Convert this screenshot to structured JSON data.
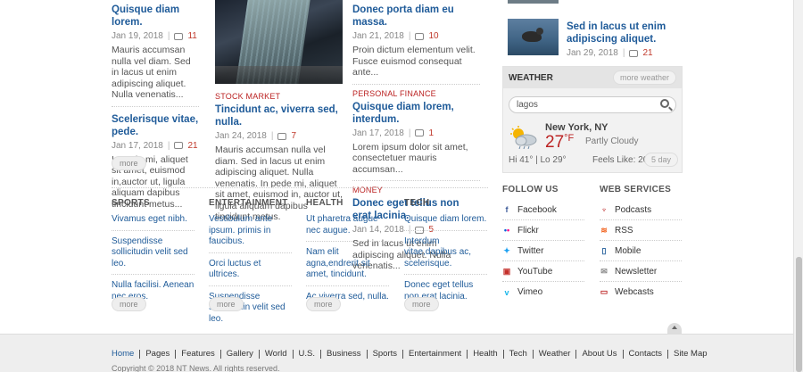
{
  "col1": {
    "articles": [
      {
        "title": "Quisque diam lorem.",
        "date": "Jan 19, 2018",
        "comments": "11",
        "excerpt": "Mauris accumsan nulla vel diam. Sed in lacus ut enim adipiscing aliquet. Nulla venenatis..."
      },
      {
        "title": "Scelerisque vitae, pede.",
        "date": "Jan 17, 2018",
        "comments": "21",
        "excerpt": "In pede mi, aliquet sit amet, euismod in,auctor ut, ligula aliquam dapibus tincidunt metus..."
      }
    ],
    "more": "more"
  },
  "col2": {
    "category": "STOCK MARKET",
    "title": "Tincidunt ac, viverra sed, nulla.",
    "date": "Jan 24, 2018",
    "comments": "7",
    "excerpt": "Mauris accumsan nulla vel diam. Sed in lacus ut enim adipiscing aliquet. Nulla venenatis. In pede mi, aliquet sit amet, euismod in, auctor ut, ligula aliquam dapibus tincidunt metus."
  },
  "col3": {
    "articles": [
      {
        "category": "",
        "title": "Donec porta diam eu massa.",
        "date": "Jan 21, 2018",
        "comments": "10",
        "excerpt": "Proin dictum elementum velit. Fusce euismod consequat ante..."
      },
      {
        "category": "PERSONAL FINANCE",
        "title": "Quisque diam lorem, interdum.",
        "date": "Jan 17, 2018",
        "comments": "1",
        "excerpt": "Lorem ipsum dolor sit amet, consectetuer mauris accumsan..."
      },
      {
        "category": "MONEY",
        "title": "Donec eget tellus non erat lacinia.",
        "date": "Jan 14, 2018",
        "comments": "5",
        "excerpt": "Sed in lacus ut enim adipiscing aliquet. Nulla venenatis..."
      }
    ]
  },
  "sidebar_article": {
    "title": "Sed in lacus ut enim adipiscing aliquet.",
    "date": "Jan 29, 2018",
    "comments": "21"
  },
  "weather": {
    "heading": "WEATHER",
    "more": "more weather",
    "search_value": "lagos",
    "city": "New York, NY",
    "temp": "27",
    "unit": "°F",
    "condition": "Partly Cloudy",
    "hilo": "Hi 41° | Lo 29°",
    "feels": "Feels Like: 20°",
    "five_day": "5 day"
  },
  "categories": [
    {
      "heading": "SPORTS",
      "links": [
        "Vivamus eget nibh.",
        "Suspendisse sollicitudin velit sed leo.",
        "Nulla facilisi. Aenean nec eros."
      ],
      "more": "more"
    },
    {
      "heading": "ENTERTAINMENT",
      "links": [
        "Vestibulum ante ipsum. primis in faucibus.",
        "Orci luctus et ultrices.",
        "Suspendisse sollicitudin velit sed leo."
      ],
      "more": "more"
    },
    {
      "heading": "HEALTH",
      "links": [
        "Ut pharetra augue nec augue.",
        "Nam elit agna,endrerit sit amet, tincidunt.",
        "Ac viverra sed, nulla."
      ],
      "more": "more"
    },
    {
      "heading": "TECH",
      "links": [
        "Quisque diam lorem.",
        "Interdum vitae,dapibus ac, scelerisque.",
        "Donec eget tellus non erat lacinia."
      ],
      "more": "more"
    }
  ],
  "follow_us": {
    "heading": "FOLLOW US",
    "items": [
      {
        "label": "Facebook",
        "icon": "facebook-icon"
      },
      {
        "label": "Flickr",
        "icon": "flickr-icon"
      },
      {
        "label": "Twitter",
        "icon": "twitter-icon"
      },
      {
        "label": "YouTube",
        "icon": "youtube-icon"
      },
      {
        "label": "Vimeo",
        "icon": "vimeo-icon"
      }
    ]
  },
  "web_services": {
    "heading": "WEB SERVICES",
    "items": [
      {
        "label": "Podcasts",
        "icon": "podcast-icon"
      },
      {
        "label": "RSS",
        "icon": "rss-icon"
      },
      {
        "label": "Mobile",
        "icon": "mobile-icon"
      },
      {
        "label": "Newsletter",
        "icon": "envelope-icon"
      },
      {
        "label": "Webcasts",
        "icon": "monitor-icon"
      }
    ]
  },
  "footer": {
    "nav": [
      "Home",
      "Pages",
      "Features",
      "Gallery",
      "World",
      "U.S.",
      "Business",
      "Sports",
      "Entertainment",
      "Health",
      "Tech",
      "Weather",
      "About Us",
      "Contacts",
      "Site Map"
    ],
    "copyright": "Copyright © 2018 NT News. All rights reserved."
  },
  "colors": {
    "link": "#1f5b99",
    "accent": "#b22222",
    "footer_bg": "#eeeeee"
  }
}
